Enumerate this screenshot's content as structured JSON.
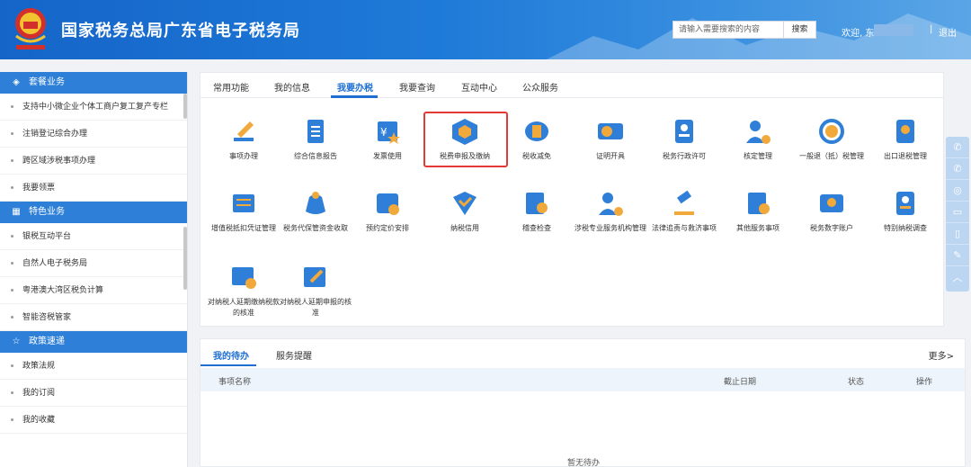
{
  "header": {
    "site_title": "国家税务总局广东省电子税务局",
    "search_placeholder": "请输入需要搜索的内容",
    "search_button": "搜索",
    "welcome": "欢迎, 东",
    "separator": "|",
    "logout": "退出"
  },
  "sidebar": {
    "sections": [
      {
        "title": "套餐业务",
        "icon": "layers-icon",
        "items": [
          "支持中小微企业个体工商户复工复产专栏",
          "注销登记综合办理",
          "跨区域涉税事项办理",
          "我要领票"
        ]
      },
      {
        "title": "特色业务",
        "icon": "grid-icon",
        "items": [
          "银税互动平台",
          "自然人电子税务局",
          "粤港澳大湾区税负计算",
          "智能咨税管家"
        ]
      },
      {
        "title": "政策速递",
        "icon": "star-icon",
        "items": [
          "政策法规",
          "我的订阅",
          "我的收藏"
        ]
      }
    ]
  },
  "tabs": [
    "常用功能",
    "我的信息",
    "我要办税",
    "我要查询",
    "互动中心",
    "公众服务"
  ],
  "active_tab": "我要办税",
  "services": [
    {
      "label": "事项办理",
      "icon": "pen-icon",
      "color": "#2f7fd8"
    },
    {
      "label": "综合信息报告",
      "icon": "document-icon",
      "color": "#2f7fd8"
    },
    {
      "label": "发票使用",
      "icon": "invoice-icon",
      "color": "#2f7fd8"
    },
    {
      "label": "税费申报及缴纳",
      "icon": "box-yuan-icon",
      "color": "#2f7fd8"
    },
    {
      "label": "税收减免",
      "icon": "coins-icon",
      "color": "#2f7fd8"
    },
    {
      "label": "证明开具",
      "icon": "ticket-icon",
      "color": "#2f7fd8"
    },
    {
      "label": "税务行政许可",
      "icon": "id-card-icon",
      "color": "#2f7fd8"
    },
    {
      "label": "核定管理",
      "icon": "user-gear-icon",
      "color": "#2f7fd8"
    },
    {
      "label": "一般退（抵）税管理",
      "icon": "refund-icon",
      "color": "#2f7fd8"
    },
    {
      "label": "出口退税管理",
      "icon": "export-refund-icon",
      "color": "#2f7fd8"
    },
    {
      "label": "增值税抵扣凭证管理",
      "icon": "voucher-icon",
      "color": "#2f7fd8"
    },
    {
      "label": "税务代保管资金收取",
      "icon": "money-bag-icon",
      "color": "#2f7fd8"
    },
    {
      "label": "预约定价安排",
      "icon": "calendar-icon",
      "color": "#2f7fd8"
    },
    {
      "label": "纳税信用",
      "icon": "credit-icon",
      "color": "#2f7fd8"
    },
    {
      "label": "稽查检查",
      "icon": "inspect-icon",
      "color": "#2f7fd8"
    },
    {
      "label": "涉税专业服务机构管理",
      "icon": "agency-icon",
      "color": "#2f7fd8"
    },
    {
      "label": "法律追责与救济事项",
      "icon": "gavel-icon",
      "color": "#2f7fd8"
    },
    {
      "label": "其他服务事项",
      "icon": "service-icon",
      "color": "#2f7fd8"
    },
    {
      "label": "税务数字账户",
      "icon": "account-icon",
      "color": "#2f7fd8"
    },
    {
      "label": "特别纳税调查",
      "icon": "survey-icon",
      "color": "#2f7fd8"
    },
    {
      "label": "对纳税人延期缴纳税款的核准",
      "icon": "defer-pay-icon",
      "color": "#2f7fd8"
    },
    {
      "label": "对纳税人延期申报的核准",
      "icon": "defer-file-icon",
      "color": "#2f7fd8"
    }
  ],
  "highlight_color": "#e53935",
  "todo": {
    "tabs": [
      "我的待办",
      "服务提醒"
    ],
    "more": "更多>",
    "columns": [
      "事项名称",
      "截止日期",
      "状态",
      "操作"
    ],
    "empty": "暂无待办"
  },
  "float_bar": [
    "wechat-icon",
    "wechat-icon",
    "weibo-icon",
    "tablet-icon",
    "mobile-icon",
    "edit-icon",
    "up-arrow-icon"
  ]
}
